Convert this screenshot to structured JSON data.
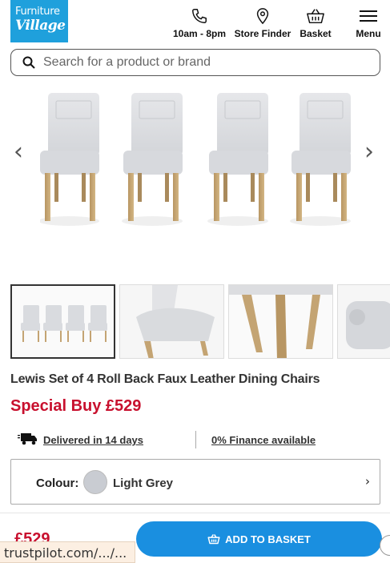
{
  "header": {
    "logo_line1": "Furniture",
    "logo_line2": "Village",
    "nav": [
      {
        "label": "10am - 8pm",
        "icon": "phone-icon"
      },
      {
        "label": "Store Finder",
        "icon": "location-pin-icon"
      },
      {
        "label": "Basket",
        "icon": "basket-icon"
      },
      {
        "label": "Menu",
        "icon": "hamburger-menu-icon"
      }
    ]
  },
  "search": {
    "placeholder": "Search for a product or brand",
    "value": ""
  },
  "gallery": {
    "prev": "‹",
    "next": "›"
  },
  "product": {
    "title": "Lewis Set of 4 Roll Back Faux Leather Dining Chairs",
    "price_label": "Special Buy £529"
  },
  "info": {
    "delivery": "Delivered in 14 days",
    "finance": "0% Finance available"
  },
  "colour": {
    "label": "Colour:",
    "value": "Light Grey",
    "swatch_color": "#c9ccd2",
    "chevron": "›"
  },
  "bottom_bar": {
    "price": "£529",
    "add_to_basket": "ADD TO BASKET"
  },
  "status_url": "trustpilot.com/.../..."
}
